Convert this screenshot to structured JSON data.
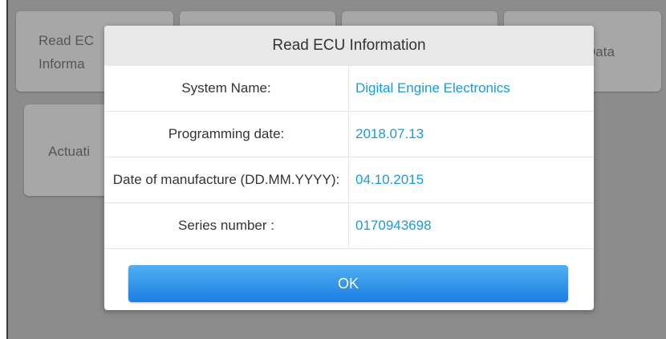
{
  "background": {
    "tiles": [
      {
        "line1": "Read EC",
        "line2": "Informa"
      },
      {
        "line1": "Actuati"
      },
      {
        "line1": "Data"
      }
    ]
  },
  "dialog": {
    "title": "Read ECU Information",
    "rows": [
      {
        "label": "System Name:",
        "value": "Digital Engine Electronics"
      },
      {
        "label": "Programming date:",
        "value": "2018.07.13"
      },
      {
        "label": "Date of manufacture (DD.MM.YYYY):",
        "value": "04.10.2015"
      },
      {
        "label": "Series number :",
        "value": "0170943698"
      }
    ],
    "ok_label": "OK"
  },
  "colors": {
    "value_text": "#1c9ad6",
    "ok_button_top": "#52aff3",
    "ok_button_bottom": "#1b7ee3",
    "overlay": "#8c8c8c"
  }
}
